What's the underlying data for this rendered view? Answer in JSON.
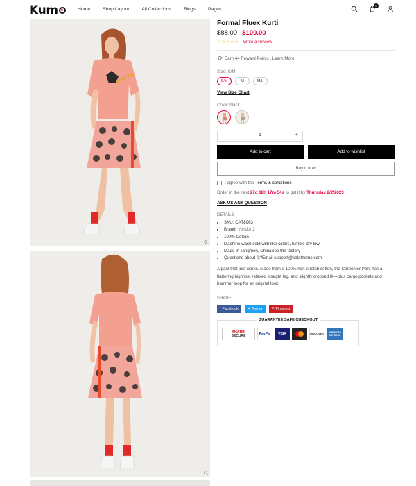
{
  "header": {
    "logo": "Kum",
    "nav": [
      "Home",
      "Shop Layout",
      "All Collections",
      "Blogs",
      "Pages"
    ],
    "cart_count": "0"
  },
  "product": {
    "title": "Formal Fluex Kurti",
    "price": "$88.00",
    "price_sep": "-",
    "old_price": "$100.00",
    "stars": "☆☆☆☆☆",
    "write_review": "Write a Review",
    "reward": "Earn 44 Reward Points . Learn More.",
    "size_label": "Size: S/M",
    "sizes": [
      "S/M",
      "M",
      "M/L"
    ],
    "size_chart": "View Size Chart",
    "color_label": "Color: black",
    "quantity": "1",
    "add_to_cart": "Add to cart",
    "add_to_wishlist": "Add to wishlist",
    "buy_now": "Buy it now",
    "agree_text": "I agree with the",
    "terms": "Terms & conditions",
    "order_prefix": "Order in the next",
    "order_timer": "27d 18h 17m 54s",
    "order_mid": "to get it by",
    "order_date": "Thursday 2/2/2023",
    "ask": "ASK US ANY QUESTION",
    "details_label": "DETAILS",
    "details": [
      {
        "label": "SKU:",
        "value": "CA78963"
      },
      {
        "label": "Brand:",
        "value": "Vendor 2"
      },
      {
        "label": "100% Cotton",
        "value": ""
      },
      {
        "label": "Machine wash cold with like colors, tumble dry low",
        "value": ""
      },
      {
        "label": "Made in jiangmen, ChinaSee the factory",
        "value": ""
      },
      {
        "label": "Questions about fit?Email support@kalatheme.com",
        "value": ""
      }
    ],
    "description": "A pant that just works. Made from a 100% non-stretch cotton, the Carpenter Pant has a flattering highrise, relaxed straight leg, and slightly cropped fit—plus cargo pockets and hammer loop for an original look.",
    "share_label": "SHARE",
    "share": {
      "facebook": "Facebook",
      "twitter": "Twitter",
      "pinterest": "Pinterest"
    },
    "safe_checkout": "GUARANTEE SAFE CHECKOUT",
    "badges": {
      "mcafee_1": "McAfee",
      "mcafee_2": "SECURE",
      "paypal": "PayPal",
      "visa": "VISA",
      "discover": "DISCOVER",
      "amex": "AMERICAN EXPRESS"
    }
  },
  "colors": {
    "accent": "#e4003a",
    "shirt": "#f4a090",
    "skirt": "#f2a59a"
  }
}
